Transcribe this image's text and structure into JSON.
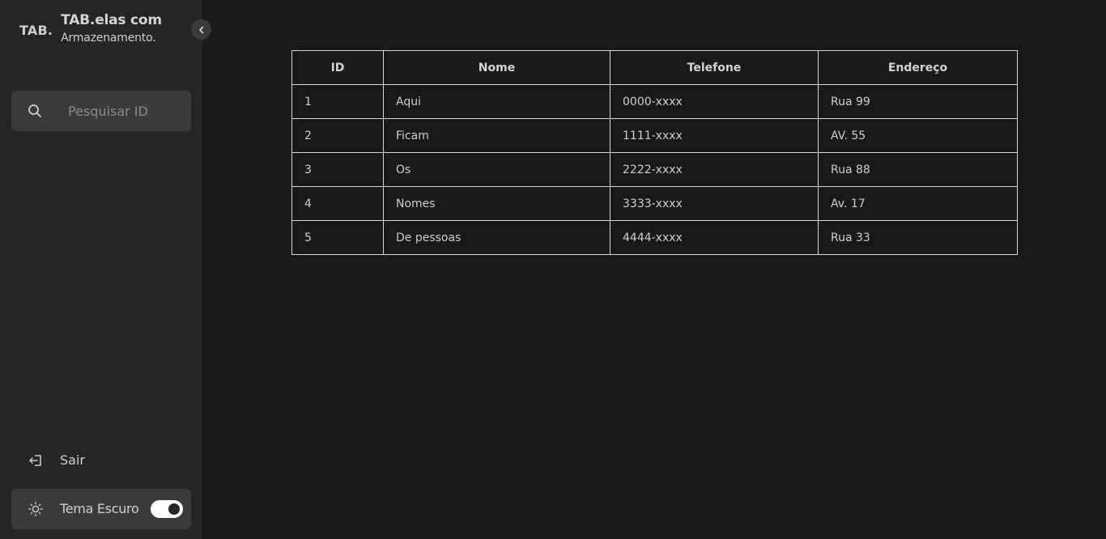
{
  "sidebar": {
    "logo": "TAB.",
    "title": "TAB.elas com",
    "subtitle": "Armazenamento.",
    "search": {
      "placeholder": "Pesquisar ID",
      "value": ""
    },
    "logout_label": "Sair",
    "theme_label": "Tema Escuro",
    "theme_dark_enabled": true
  },
  "table": {
    "headers": [
      "ID",
      "Nome",
      "Telefone",
      "Endereço"
    ],
    "rows": [
      [
        "1",
        "Aqui",
        "0000-xxxx",
        "Rua 99"
      ],
      [
        "2",
        "Ficam",
        "1111-xxxx",
        "AV. 55"
      ],
      [
        "3",
        "Os",
        "2222-xxxx",
        "Rua 88"
      ],
      [
        "4",
        "Nomes",
        "3333-xxxx",
        "Av. 17"
      ],
      [
        "5",
        "De pessoas",
        "4444-xxxx",
        "Rua 33"
      ]
    ]
  },
  "colors": {
    "background": "#18191a",
    "sidebar": "#242526",
    "panel": "#3a3b3c",
    "text": "#cfcfcf"
  },
  "icons": {
    "collapse": "chevron-left-icon",
    "search": "search-icon",
    "logout": "logout-icon",
    "theme": "sun-icon"
  }
}
